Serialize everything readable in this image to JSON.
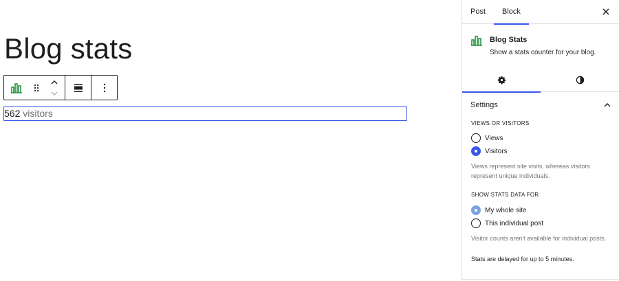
{
  "editor": {
    "post_title": "Blog stats",
    "stats_block": {
      "count": "562",
      "label": " visitors"
    }
  },
  "toolbar": {
    "block_icon": "bar-chart-icon",
    "drag_icon": "drag-handle-icon",
    "move_up_icon": "chevron-up-icon",
    "move_down_icon": "chevron-down-icon",
    "align_icon": "align-none-icon",
    "options_icon": "more-vertical-icon"
  },
  "sidebar": {
    "tabs": [
      {
        "label": "Post"
      },
      {
        "label": "Block"
      }
    ],
    "close_icon": "close-icon",
    "block_card": {
      "title": "Blog Stats",
      "description": "Show a stats counter for your blog."
    },
    "subtabs": [
      {
        "icon": "gear-icon"
      },
      {
        "icon": "contrast-icon"
      }
    ],
    "settings": {
      "title": "Settings",
      "views_or_visitors": {
        "label": "VIEWS OR VISITORS",
        "options": [
          "Views",
          "Visitors"
        ],
        "selected": "Visitors",
        "help": "Views represent site visits, whereas visitors represent unique individuals."
      },
      "show_stats_for": {
        "label": "SHOW STATS DATA FOR",
        "options": [
          "My whole site",
          "This individual post"
        ],
        "selected": "My whole site",
        "help": "Visitor counts aren't available for individual posts."
      },
      "delay_note": "Stats are delayed for up to 5 minutes."
    }
  },
  "colors": {
    "accent": "#3858e9",
    "block_icon_green": "#1a8e36",
    "muted_text": "#757575"
  }
}
